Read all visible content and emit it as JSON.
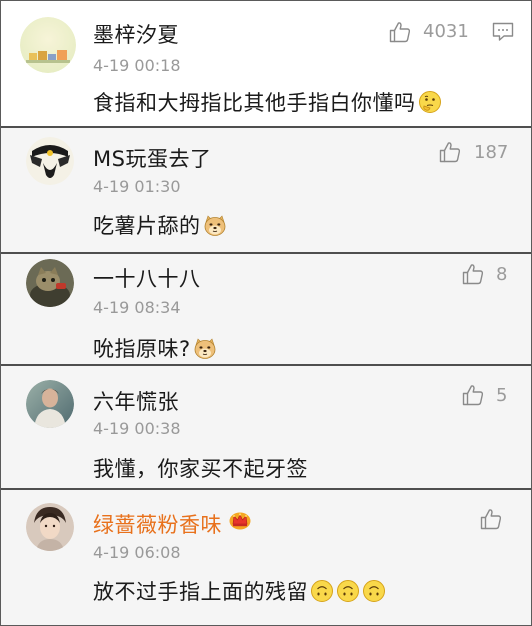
{
  "comments": [
    {
      "username": "墨梓汐夏",
      "time": "4-19 00:18",
      "text": "食指和大拇指比其他手指白你懂吗",
      "likes": "4031",
      "emoji": "thinking-face-emoji"
    },
    {
      "username": "MS玩蛋去了",
      "time": "4-19 01:30",
      "text": "吃薯片舔的",
      "likes": "187",
      "emoji": "doge-emoji"
    },
    {
      "username": "一十八十八",
      "time": "4-19 08:34",
      "text": "吮指原味?",
      "likes": "8",
      "emoji": "doge-emoji"
    },
    {
      "username": "六年慌张",
      "time": "4-19 00:38",
      "text": "我懂，你家买不起牙签",
      "likes": "5"
    },
    {
      "username": "绿蔷薇粉香味",
      "time": "4-19 06:08",
      "text": "放不过手指上面的残留",
      "likes": "",
      "badge": "crown-badge-icon",
      "emoji": "upside-down-face-emoji"
    }
  ],
  "colors": {
    "reply_bg": "#f5f5f5",
    "separator": "#4f4f4f",
    "vip_name": "#e8711c",
    "meta_gray": "#999999"
  }
}
